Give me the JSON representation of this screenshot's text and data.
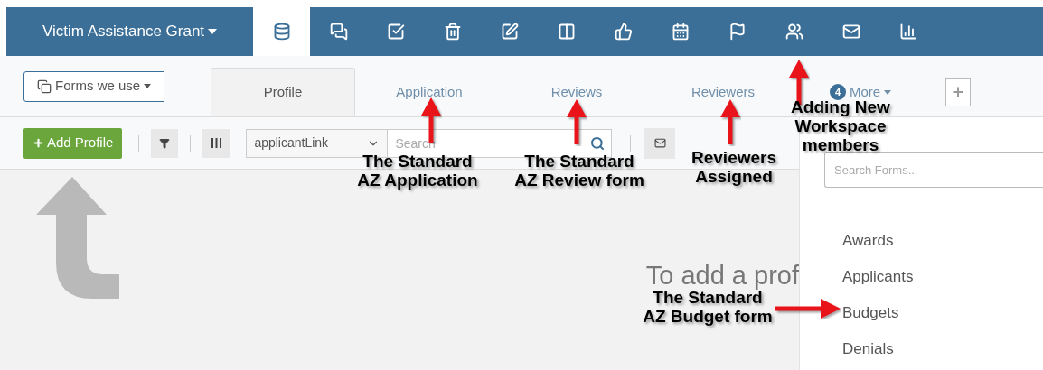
{
  "workspace": {
    "title": "Victim Assistance Grant"
  },
  "toolbar": [
    {
      "kind": "database",
      "selected": true
    },
    {
      "kind": "chat",
      "selected": false
    },
    {
      "kind": "check",
      "selected": false
    },
    {
      "kind": "trash",
      "selected": false
    },
    {
      "kind": "edit",
      "selected": false
    },
    {
      "kind": "columns",
      "selected": false
    },
    {
      "kind": "like",
      "selected": false
    },
    {
      "kind": "calendar",
      "selected": false
    },
    {
      "kind": "flag",
      "selected": false
    },
    {
      "kind": "users",
      "selected": false
    },
    {
      "kind": "mail",
      "selected": false
    },
    {
      "kind": "chart",
      "selected": false
    }
  ],
  "forms_menu": {
    "label": "Forms we use"
  },
  "tabs": [
    {
      "label": "Profile",
      "selected": true
    },
    {
      "label": "Application",
      "selected": false
    },
    {
      "label": "Reviews",
      "selected": false
    },
    {
      "label": "Reviewers",
      "selected": false
    }
  ],
  "more": {
    "badge": "4",
    "label": "More"
  },
  "actions": {
    "add_button": "Add Profile",
    "field_select": "applicantLink",
    "search": {
      "placeholder": "Search"
    }
  },
  "empty_message": "To add a prof",
  "forms_panel": {
    "search": {
      "placeholder": "Search Forms..."
    },
    "items": [
      "Awards",
      "Applicants",
      "Budgets",
      "Denials"
    ]
  },
  "annotations": [
    {
      "lines": [
        "The Standard",
        "AZ Application"
      ]
    },
    {
      "lines": [
        "The Standard",
        "AZ Review form"
      ]
    },
    {
      "lines": [
        "Reviewers",
        "Assigned"
      ]
    },
    {
      "lines": [
        "Adding New",
        "Workspace",
        "members"
      ]
    },
    {
      "lines": [
        "The Standard",
        "AZ Budget form"
      ]
    }
  ]
}
